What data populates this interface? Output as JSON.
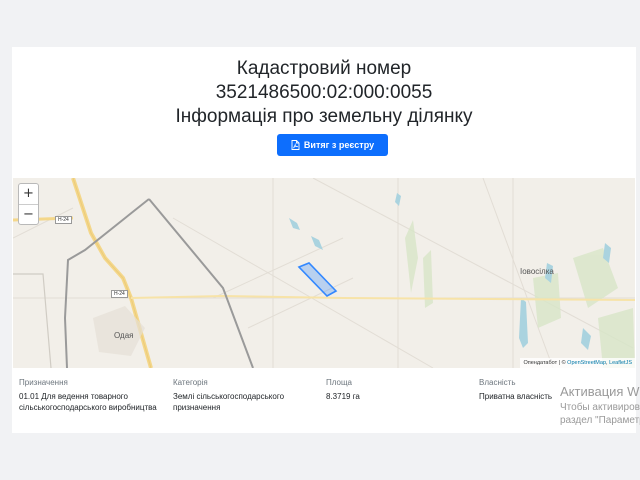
{
  "header": {
    "line1": "Кадастровий номер",
    "line2": "3521486500:02:000:0055",
    "line3": "Інформація про земельну ділянку"
  },
  "actions": {
    "extract_label": "Витяг з реєстру",
    "extract_icon": "pdf-file-icon"
  },
  "map": {
    "zoom_in": "+",
    "zoom_out": "−",
    "attribution_prefix": "Опендатабот | © ",
    "attribution_osm": "OpenStreetMap",
    "attribution_sep": ", ",
    "attribution_leaflet": "LeafletJS",
    "places": {
      "odaia": "Одая",
      "iovosilka": "Іовосілка"
    },
    "road_labels": [
      "H-24",
      "H-24"
    ],
    "parcel_color": "#3388ff"
  },
  "info": {
    "purpose_label": "Призначення",
    "purpose_value": "01.01 Для ведення товарного сільськогосподарського виробництва",
    "category_label": "Категорія",
    "category_value": "Землі сільськогосподарського призначення",
    "area_label": "Площа",
    "area_value": "8.3719 га",
    "ownership_label": "Власність",
    "ownership_value": "Приватна власність"
  },
  "os_watermark": {
    "line1": "Активация Windows",
    "line2": "Чтобы активировать Windows, перейдите в",
    "line3": "раздел \"Параметры\"."
  }
}
